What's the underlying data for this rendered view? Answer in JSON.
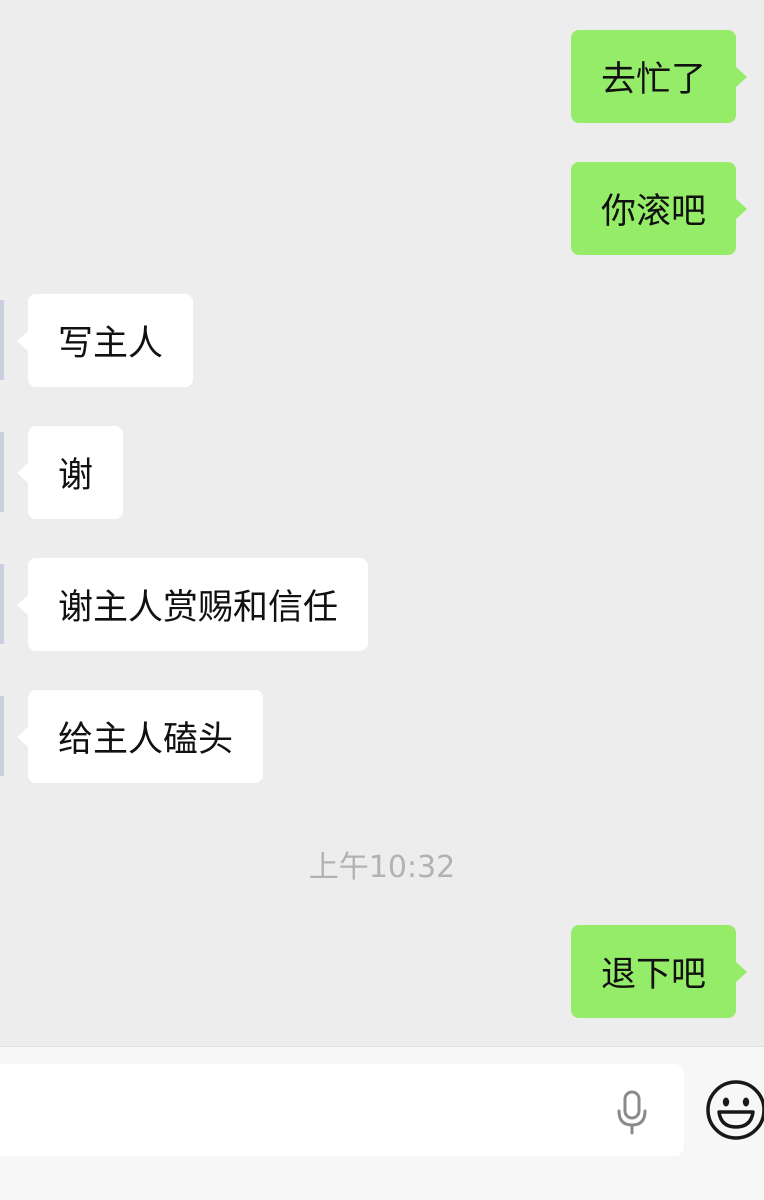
{
  "messages": [
    {
      "direction": "out",
      "text": "去忙了"
    },
    {
      "direction": "out",
      "text": "你滚吧"
    },
    {
      "direction": "in",
      "text": "写主人"
    },
    {
      "direction": "in",
      "text": "谢"
    },
    {
      "direction": "in",
      "text": "谢主人赏赐和信任"
    },
    {
      "direction": "in",
      "text": "给主人磕头"
    },
    {
      "direction": "out",
      "text": "退下吧"
    }
  ],
  "timestamp": "上午10:32",
  "input_bar": {
    "value": "",
    "voice_icon": "microphone-icon",
    "emoji_icon": "smiley-face-icon"
  },
  "colors": {
    "background": "#ededed",
    "outgoing_bubble": "#95ec69",
    "incoming_bubble": "#ffffff",
    "timestamp_text": "#b2b2b2"
  }
}
